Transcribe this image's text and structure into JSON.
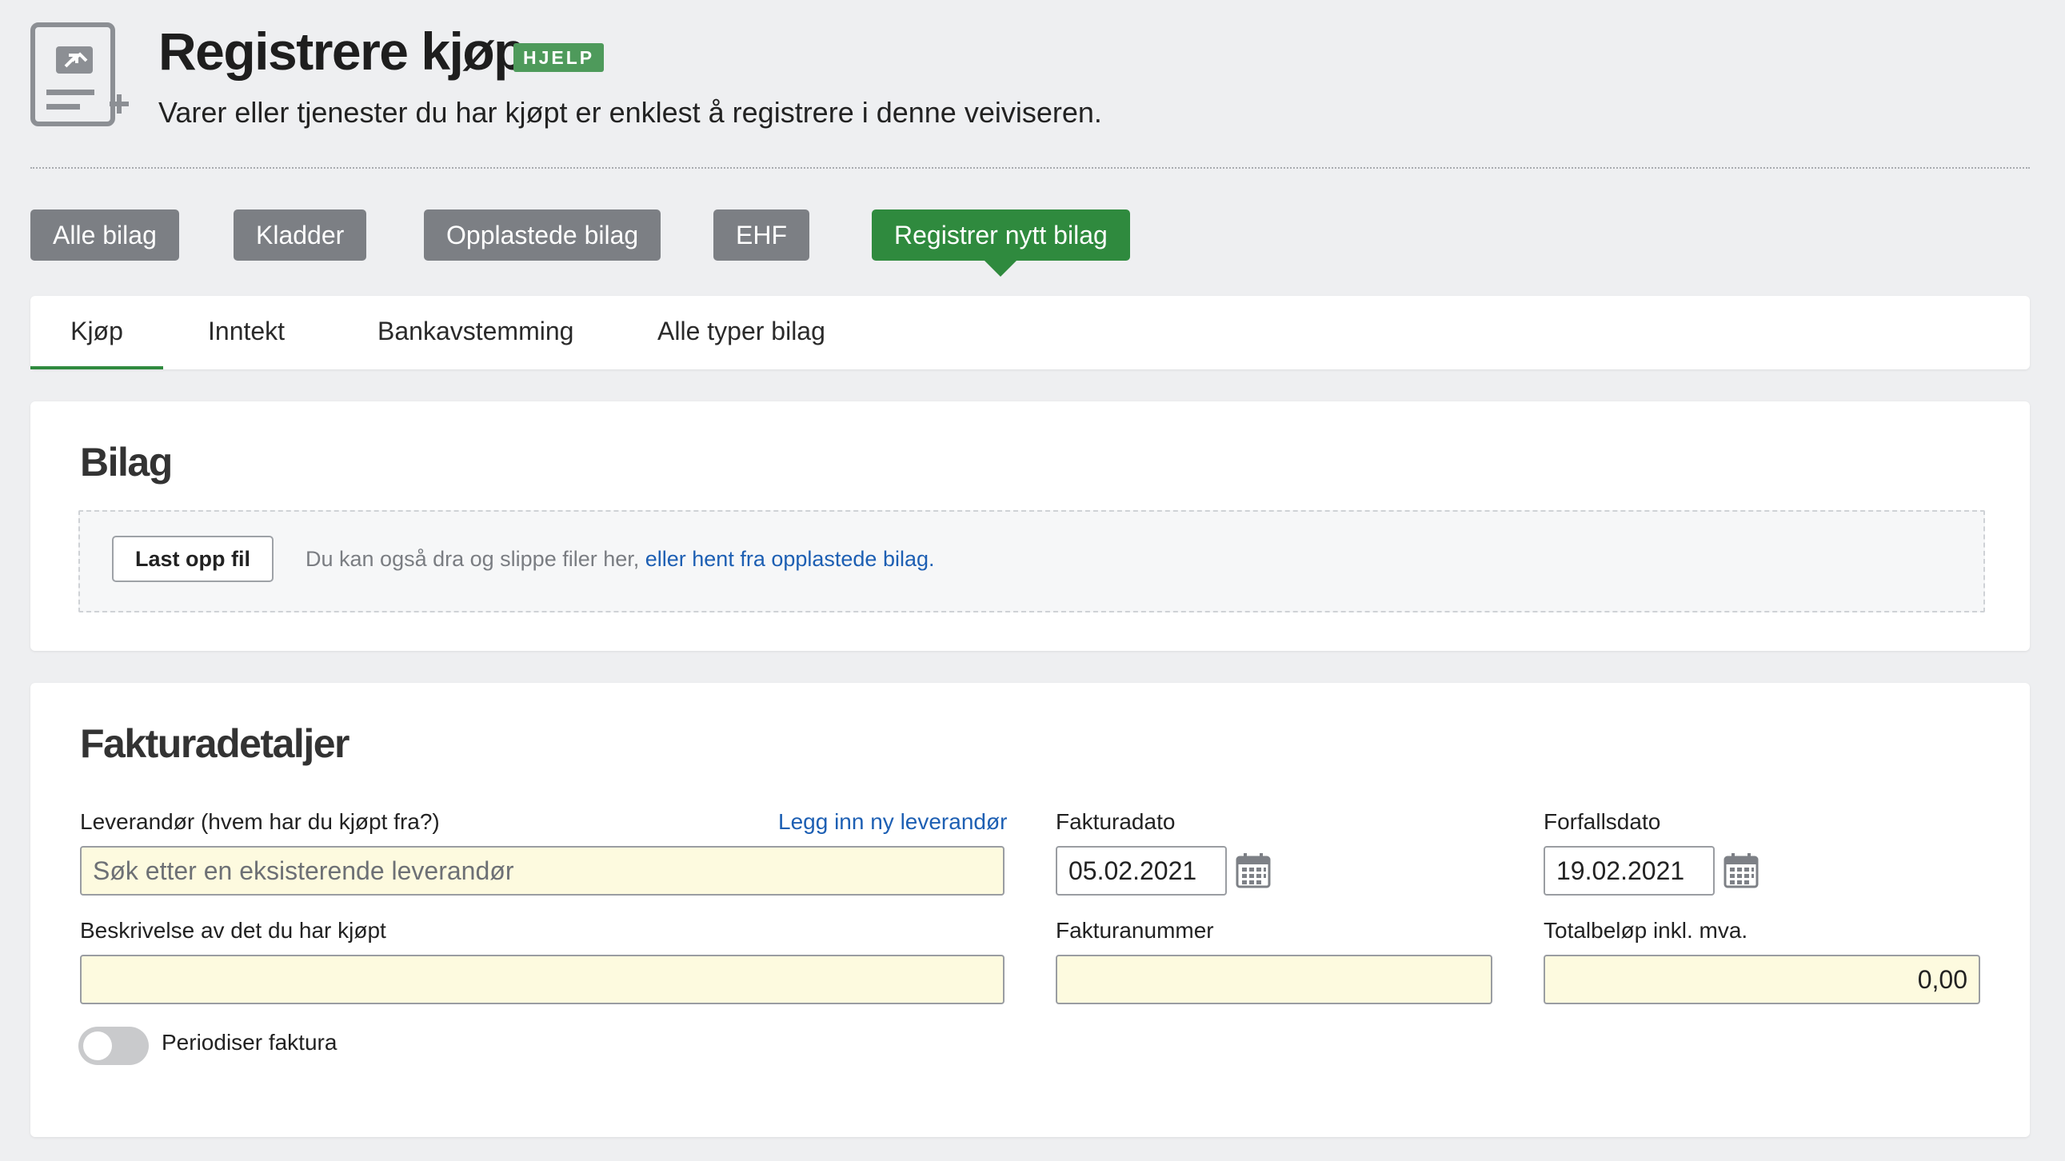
{
  "header": {
    "icon": "receipt-add-icon",
    "title": "Registrere kjøp",
    "help_badge": "HJELP",
    "subtitle": "Varer eller tjenester du har kjøpt er enklest å registrere i denne veiviseren."
  },
  "nav": {
    "buttons": [
      "Alle bilag",
      "Kladder",
      "Opplastede bilag",
      "EHF",
      "Registrer nytt bilag"
    ],
    "active": "Registrer nytt bilag"
  },
  "tabs": {
    "items": [
      "Kjøp",
      "Inntekt",
      "Bankavstemming",
      "Alle typer bilag"
    ],
    "active": "Kjøp"
  },
  "bilag": {
    "title": "Bilag",
    "upload_button": "Last opp fil",
    "drop_text": "Du kan også dra og slippe filer her, ",
    "drop_link": "eller hent fra opplastede bilag."
  },
  "faktura": {
    "title": "Fakturadetaljer",
    "leverandor_label": "Leverandør (hvem har du kjøpt fra?)",
    "leverandor_link": "Legg inn ny leverandør",
    "leverandor_placeholder": "Søk etter en eksisterende leverandør",
    "fakturadato_label": "Fakturadato",
    "fakturadato_value": "05.02.2021",
    "forfallsdato_label": "Forfallsdato",
    "forfallsdato_value": "19.02.2021",
    "beskrivelse_label": "Beskrivelse av det du har kjøpt",
    "beskrivelse_value": "",
    "fakturanummer_label": "Fakturanummer",
    "fakturanummer_value": "",
    "totalbelop_label": "Totalbeløp inkl. mva.",
    "totalbelop_value": "0,00",
    "periodiser_label": "Periodiser faktura",
    "periodiser_on": false,
    "calendar_icon": "calendar-icon"
  },
  "colors": {
    "accent_green": "#2f8a3e",
    "help_badge_green": "#4e9a5b",
    "nav_gray": "#7c7f84",
    "link_blue": "#1d5fb3",
    "field_yellow": "#fdfadf",
    "background": "#eeeff1"
  }
}
